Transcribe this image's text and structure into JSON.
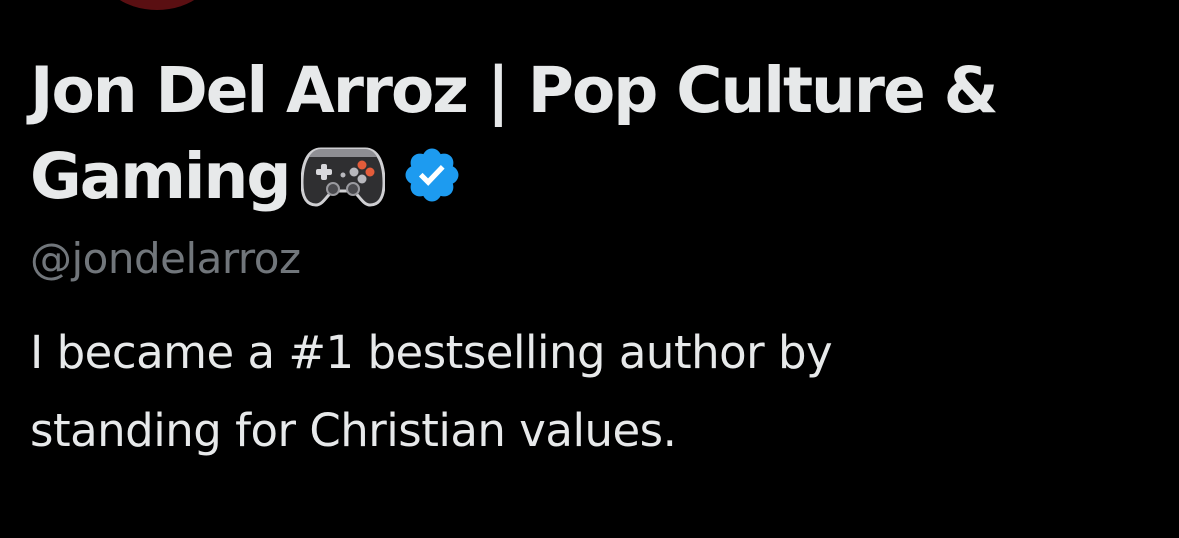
{
  "profile": {
    "display_name": "Jon Del Arroz | Pop Culture & Gaming",
    "handle": "@jondelarroz",
    "bio": "I became a #1 bestselling author by standing for Christian values."
  },
  "icons": {
    "name_emoji": "game-controller-icon",
    "verified": "verified-badge-icon"
  },
  "colors": {
    "background": "#000000",
    "text_primary": "#e7e9ea",
    "text_secondary": "#71767b",
    "verified_blue": "#1d9bf0"
  }
}
